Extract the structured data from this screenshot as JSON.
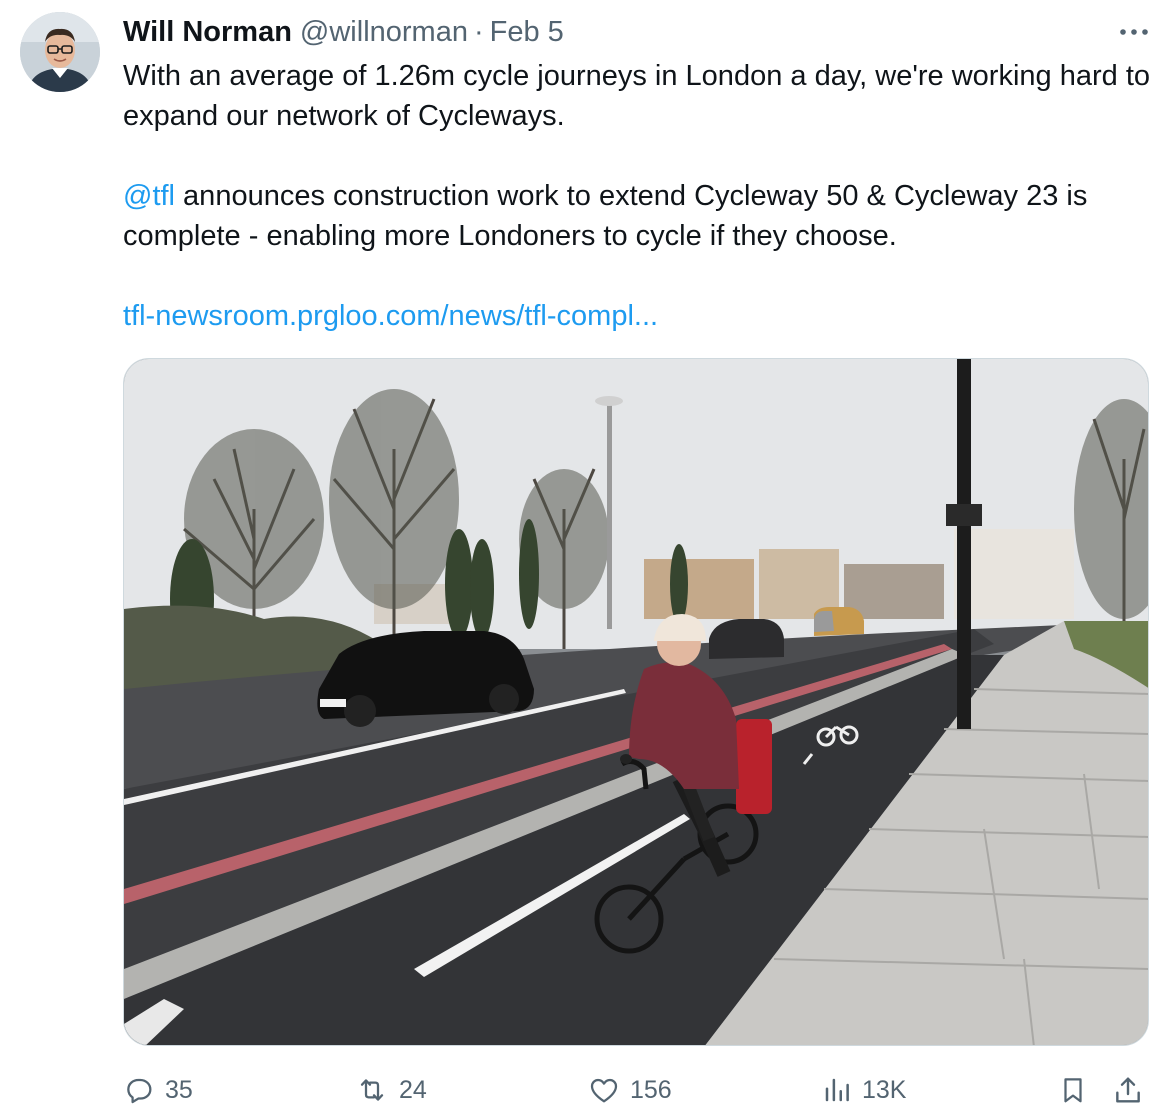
{
  "tweet": {
    "author_name": "Will Norman",
    "handle": "@willnorman",
    "separator": "·",
    "date": "Feb 5",
    "text_line1": "With an average of 1.26m cycle journeys in London a day, we're working hard to expand our network of Cycleways.",
    "mention": "@tfl",
    "text_line2": " announces construction work to extend Cycleway 50 & Cycleway 23 is complete - enabling more Londoners to cycle if they choose.",
    "link": "tfl-newsroom.prgloo.com/news/tfl-compl..."
  },
  "actions": {
    "replies": "35",
    "reposts": "24",
    "likes": "156",
    "views": "13K"
  },
  "icons": {
    "more": "more-horizontal-icon",
    "reply": "reply-icon",
    "repost": "repost-icon",
    "like": "heart-icon",
    "views": "views-chart-icon",
    "bookmark": "bookmark-icon",
    "share": "share-icon"
  },
  "colors": {
    "link": "#1d9bf0",
    "secondary_text": "#536471",
    "primary_text": "#0f1419"
  }
}
